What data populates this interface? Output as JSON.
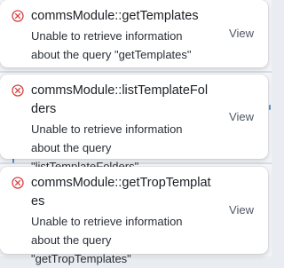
{
  "notifications": [
    {
      "title": "commsModule::getTemplates",
      "message": "Unable to retrieve information about the query \"getTemplates\"",
      "action_label": "View",
      "icon": "error-circle-x-icon"
    },
    {
      "title": "commsModule::listTemplateFolders",
      "message": "Unable to retrieve information about the query \"listTemplateFolders\"",
      "action_label": "View",
      "icon": "error-circle-x-icon"
    },
    {
      "title": "commsModule::getTropTemplates",
      "message": "Unable to retrieve information about the query \"getTropTemplates\"",
      "action_label": "View",
      "icon": "error-circle-x-icon"
    }
  ],
  "colors": {
    "error_icon": "#d93f3f",
    "toast_background": "#ffffff",
    "title_text": "#1b1f24",
    "action_text": "#505863"
  }
}
